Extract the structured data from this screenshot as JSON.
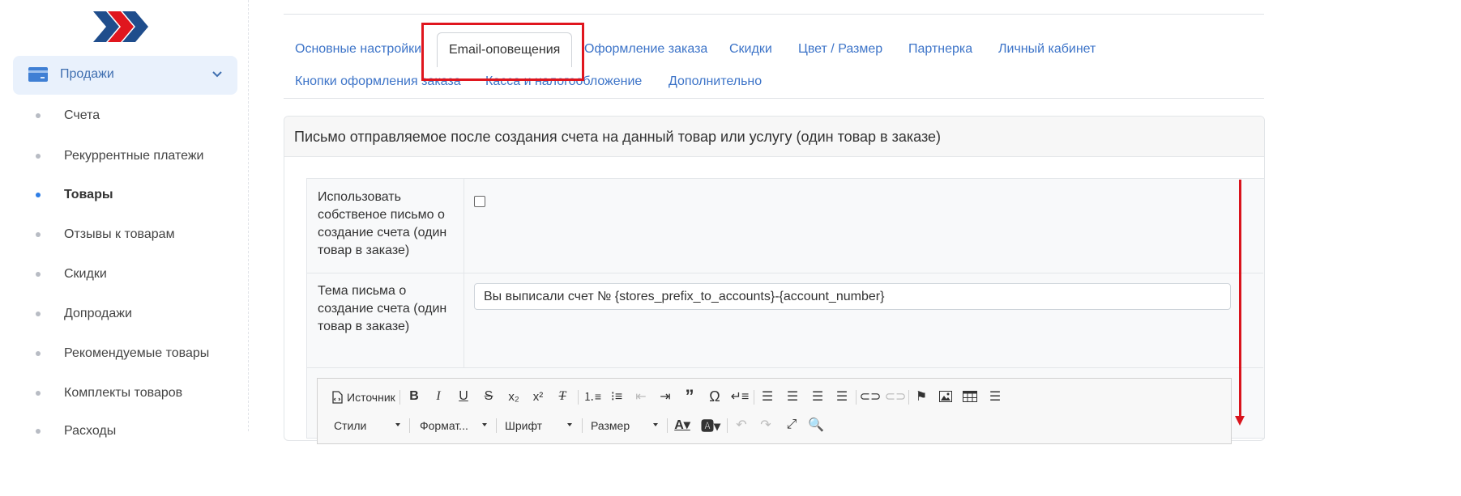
{
  "sidebar": {
    "group": {
      "label": "Продажи",
      "icon": "credit-card-icon",
      "chevron": "chevron-down-icon"
    },
    "items": [
      {
        "label": "Счета"
      },
      {
        "label": "Рекуррентные платежи"
      },
      {
        "label": "Товары",
        "active": true
      },
      {
        "label": "Отзывы к товарам"
      },
      {
        "label": "Скидки"
      },
      {
        "label": "Допродажи"
      },
      {
        "label": "Рекомендуемые товары"
      },
      {
        "label": "Комплекты товаров"
      },
      {
        "label": "Расходы"
      }
    ]
  },
  "tabs": [
    {
      "label": "Основные настройки"
    },
    {
      "label": "Email-оповещения",
      "active": true
    },
    {
      "label": "Оформление заказа"
    },
    {
      "label": "Скидки"
    },
    {
      "label": "Цвет / Размер"
    },
    {
      "label": "Партнерка"
    },
    {
      "label": "Личный кабинет"
    },
    {
      "label": "Кнопки оформления заказа"
    },
    {
      "label": "Касса и налогообложение"
    },
    {
      "label": "Дополнительно"
    }
  ],
  "card": {
    "title": "Письмо отправляемое после создания счета на данный товар или услугу (один товар в заказе)"
  },
  "form": {
    "own_letter_label": "Использовать собственое письмо о создание счета (один товар в заказе)",
    "own_letter_checked": false,
    "subject_label": "Тема письма о создание счета (один товар в заказе)",
    "subject_value": "Вы выписали счет № {stores_prefix_to_accounts}-{account_number}"
  },
  "editor": {
    "source_label": "Источник",
    "styles_label": "Стили",
    "format_label": "Формат...",
    "font_label": "Шрифт",
    "size_label": "Размер"
  },
  "colors": {
    "accent": "#3d74c8",
    "highlight": "#e0161e",
    "arrow": "#d9141c"
  }
}
